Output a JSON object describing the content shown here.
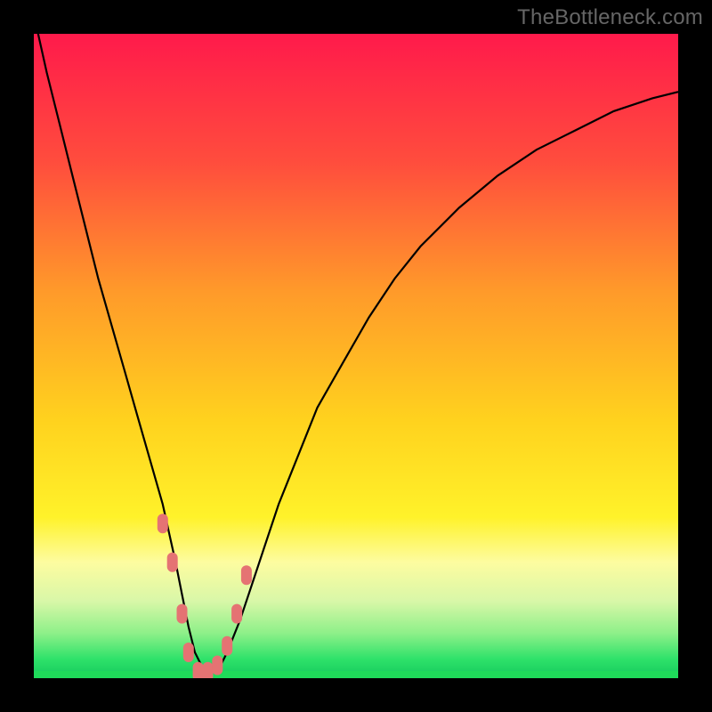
{
  "watermark": "TheBottleneck.com",
  "colors": {
    "frame": "#000000",
    "curve": "#000000",
    "marker": "#e57373",
    "green": "#1fdb5a"
  },
  "chart_data": {
    "type": "line",
    "title": "",
    "xlabel": "",
    "ylabel": "",
    "xlim": [
      0,
      100
    ],
    "ylim": [
      0,
      100
    ],
    "grid": false,
    "legend": false,
    "background_gradient_stops": [
      {
        "offset": 0,
        "color": "#ff1a4b"
      },
      {
        "offset": 20,
        "color": "#ff4d3d"
      },
      {
        "offset": 40,
        "color": "#ff9a2a"
      },
      {
        "offset": 60,
        "color": "#ffd21e"
      },
      {
        "offset": 75,
        "color": "#fff22a"
      },
      {
        "offset": 82,
        "color": "#fdfca0"
      },
      {
        "offset": 88,
        "color": "#d9f7a8"
      },
      {
        "offset": 93,
        "color": "#8ef089"
      },
      {
        "offset": 97,
        "color": "#2fe26a"
      },
      {
        "offset": 100,
        "color": "#13c95c"
      }
    ],
    "series": [
      {
        "name": "bottleneck-curve",
        "x": [
          0,
          2,
          4,
          6,
          8,
          10,
          12,
          14,
          16,
          18,
          20,
          22,
          23,
          24,
          25,
          26,
          27,
          28,
          29,
          30,
          32,
          34,
          36,
          38,
          40,
          44,
          48,
          52,
          56,
          60,
          66,
          72,
          78,
          84,
          90,
          96,
          100
        ],
        "y": [
          103,
          94,
          86,
          78,
          70,
          62,
          55,
          48,
          41,
          34,
          27,
          18,
          13,
          8,
          4,
          2,
          1,
          1,
          2,
          4,
          9,
          15,
          21,
          27,
          32,
          42,
          49,
          56,
          62,
          67,
          73,
          78,
          82,
          85,
          88,
          90,
          91
        ]
      }
    ],
    "markers": [
      {
        "x": 20.0,
        "y": 24
      },
      {
        "x": 21.5,
        "y": 18
      },
      {
        "x": 23.0,
        "y": 10
      },
      {
        "x": 24.0,
        "y": 4
      },
      {
        "x": 25.5,
        "y": 1
      },
      {
        "x": 27.0,
        "y": 1
      },
      {
        "x": 28.5,
        "y": 2
      },
      {
        "x": 30.0,
        "y": 5
      },
      {
        "x": 31.5,
        "y": 10
      },
      {
        "x": 33.0,
        "y": 16
      }
    ]
  }
}
